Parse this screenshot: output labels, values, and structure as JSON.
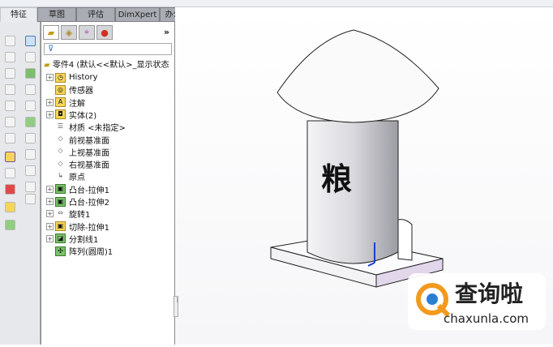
{
  "tabs": [
    {
      "label": "特征",
      "active": true
    },
    {
      "label": "草图"
    },
    {
      "label": "评估"
    },
    {
      "label": "DimXpert"
    },
    {
      "label": "办公室产品"
    }
  ],
  "panel": {
    "tabs": [
      "feature-manager",
      "property-manager",
      "configuration-manager",
      "display-manager"
    ],
    "more": "»",
    "filter_icon": "⊽",
    "root": "零件4  (默认<<默认>_显示状态",
    "items": [
      {
        "label": "History",
        "expand": true,
        "icon": "history-icon"
      },
      {
        "label": "传感器",
        "expand": false,
        "icon": "sensor-icon"
      },
      {
        "label": "注解",
        "expand": true,
        "icon": "annotation-icon"
      },
      {
        "label": "实体(2)",
        "expand": true,
        "icon": "solid-bodies-icon"
      },
      {
        "label": "材质 <未指定>",
        "expand": false,
        "icon": "material-icon"
      },
      {
        "label": "前视基准面",
        "expand": false,
        "icon": "plane-icon"
      },
      {
        "label": "上视基准面",
        "expand": false,
        "icon": "plane-icon"
      },
      {
        "label": "右视基准面",
        "expand": false,
        "icon": "plane-icon"
      },
      {
        "label": "原点",
        "expand": false,
        "icon": "origin-icon"
      },
      {
        "label": "凸台-拉伸1",
        "expand": true,
        "icon": "extrude-icon"
      },
      {
        "label": "凸台-拉伸2",
        "expand": true,
        "icon": "extrude-icon"
      },
      {
        "label": "旋转1",
        "expand": true,
        "icon": "revolve-icon"
      },
      {
        "label": "切除-拉伸1",
        "expand": true,
        "icon": "cut-extrude-icon"
      },
      {
        "label": "分割线1",
        "expand": true,
        "icon": "split-line-icon"
      },
      {
        "label": "阵列(圆周)1",
        "expand": false,
        "icon": "circular-pattern-icon"
      }
    ]
  },
  "model": {
    "text": "粮"
  },
  "watermark": {
    "title": "查询啦",
    "url": "chaxunla.com",
    "color": "#f29a1f"
  }
}
